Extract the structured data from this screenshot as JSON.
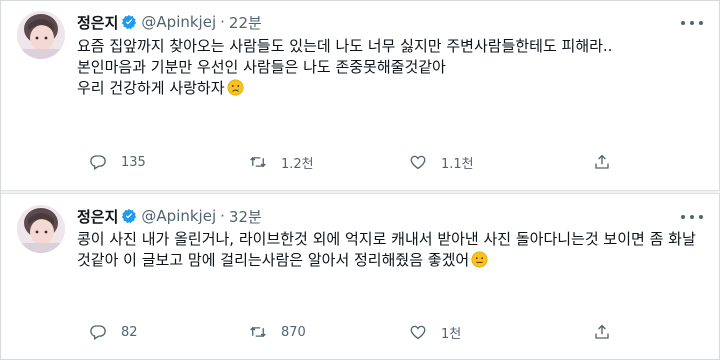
{
  "tweets": [
    {
      "name": "정은지",
      "handle": "@Apinkjej",
      "separator": "·",
      "time": "22분",
      "paragraphs": [
        "요즘 집앞까지 찾아오는 사람들도 있는데 나도 너무 싫지만 주변사람들한테도 피해라..",
        "본인마음과 기분만 우선인 사람들은 나도 존중못해줄것같아",
        "우리 건강하게 사랑하자"
      ],
      "trailing_emoji": "crying-face-emoji",
      "reply_count": "135",
      "retweet_count": "1.2천",
      "like_count": "1.1천"
    },
    {
      "name": "정은지",
      "handle": "@Apinkjej",
      "separator": "·",
      "time": "32분",
      "paragraphs": [
        "콩이 사진 내가 올린거나, 라이브한것 외에 억지로 캐내서 받아낸 사진 돌아다니는것 보이면 좀 화날것같아 이 글보고 맘에 걸리는사람은 알아서 정리해줬음 좋겠어"
      ],
      "trailing_emoji": "neutral-face-emoji",
      "reply_count": "82",
      "retweet_count": "870",
      "like_count": "1천"
    }
  ],
  "colors": {
    "text": "#0f1419",
    "secondary": "#536471",
    "verified": "#1d9bf0",
    "divider": "#eff3f4"
  },
  "icons": [
    "verified-badge-icon",
    "more-icon",
    "reply-icon",
    "retweet-icon",
    "like-icon",
    "share-icon"
  ]
}
